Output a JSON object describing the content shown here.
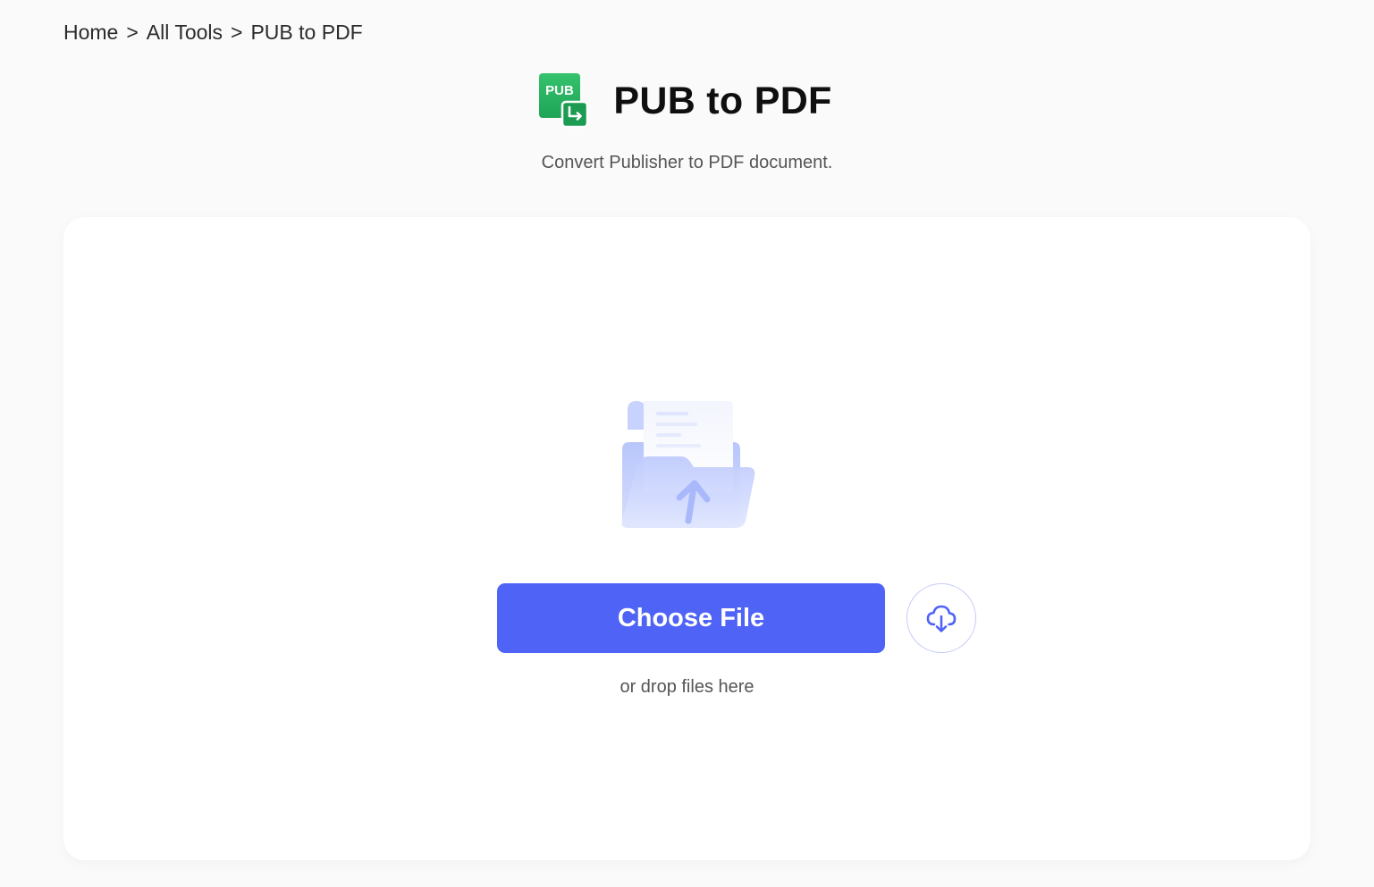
{
  "breadcrumb": {
    "items": [
      {
        "label": "Home"
      },
      {
        "label": "All Tools"
      },
      {
        "label": "PUB to PDF"
      }
    ],
    "separator": ">"
  },
  "header": {
    "icon": "pub-to-pdf-icon",
    "icon_text": "PUB",
    "title": "PUB to PDF",
    "subtitle": "Convert Publisher to PDF document."
  },
  "upload": {
    "illustration": "folder-upload-icon",
    "choose_label": "Choose File",
    "cloud_icon": "cloud-download-icon",
    "drop_hint": "or drop files here"
  },
  "colors": {
    "accent": "#4f63f7",
    "pub_green": "#22b35f",
    "background": "#fafafa",
    "card": "#ffffff"
  }
}
